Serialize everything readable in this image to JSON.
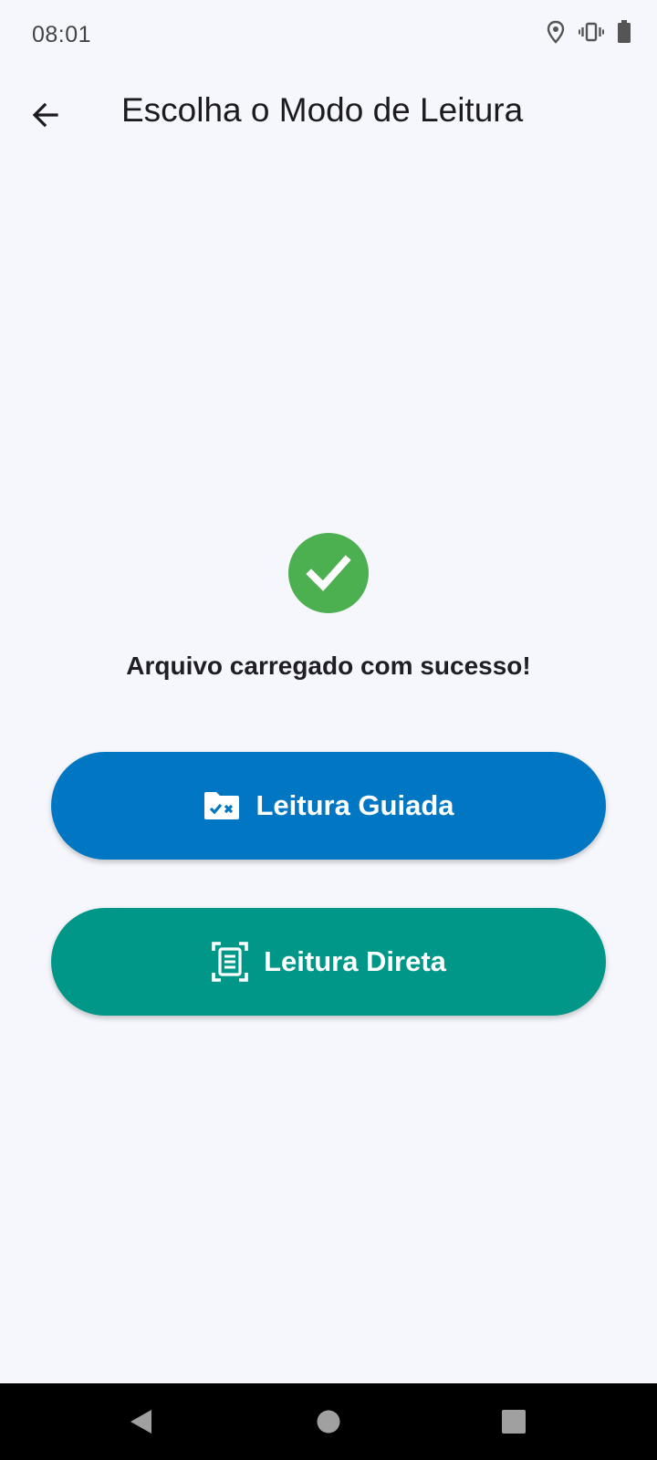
{
  "status_bar": {
    "time": "08:01",
    "icons": [
      "location-icon",
      "vibrate-icon",
      "battery-icon"
    ]
  },
  "app_bar": {
    "title": "Escolha o Modo de Leitura",
    "back_icon": "arrow-back-icon"
  },
  "main": {
    "success_icon": "check-circle-icon",
    "success_message": "Arquivo carregado com sucesso!",
    "buttons": [
      {
        "label": "Leitura Guiada",
        "icon": "folder-check-icon",
        "color": "#0177c3"
      },
      {
        "label": "Leitura Direta",
        "icon": "document-scan-icon",
        "color": "#009688"
      }
    ]
  },
  "nav_bar": {
    "icons": [
      "nav-back-icon",
      "nav-home-icon",
      "nav-recents-icon"
    ]
  },
  "colors": {
    "background": "#f5f7fc",
    "success": "#4caf50",
    "primary": "#0177c3",
    "secondary": "#009688"
  }
}
